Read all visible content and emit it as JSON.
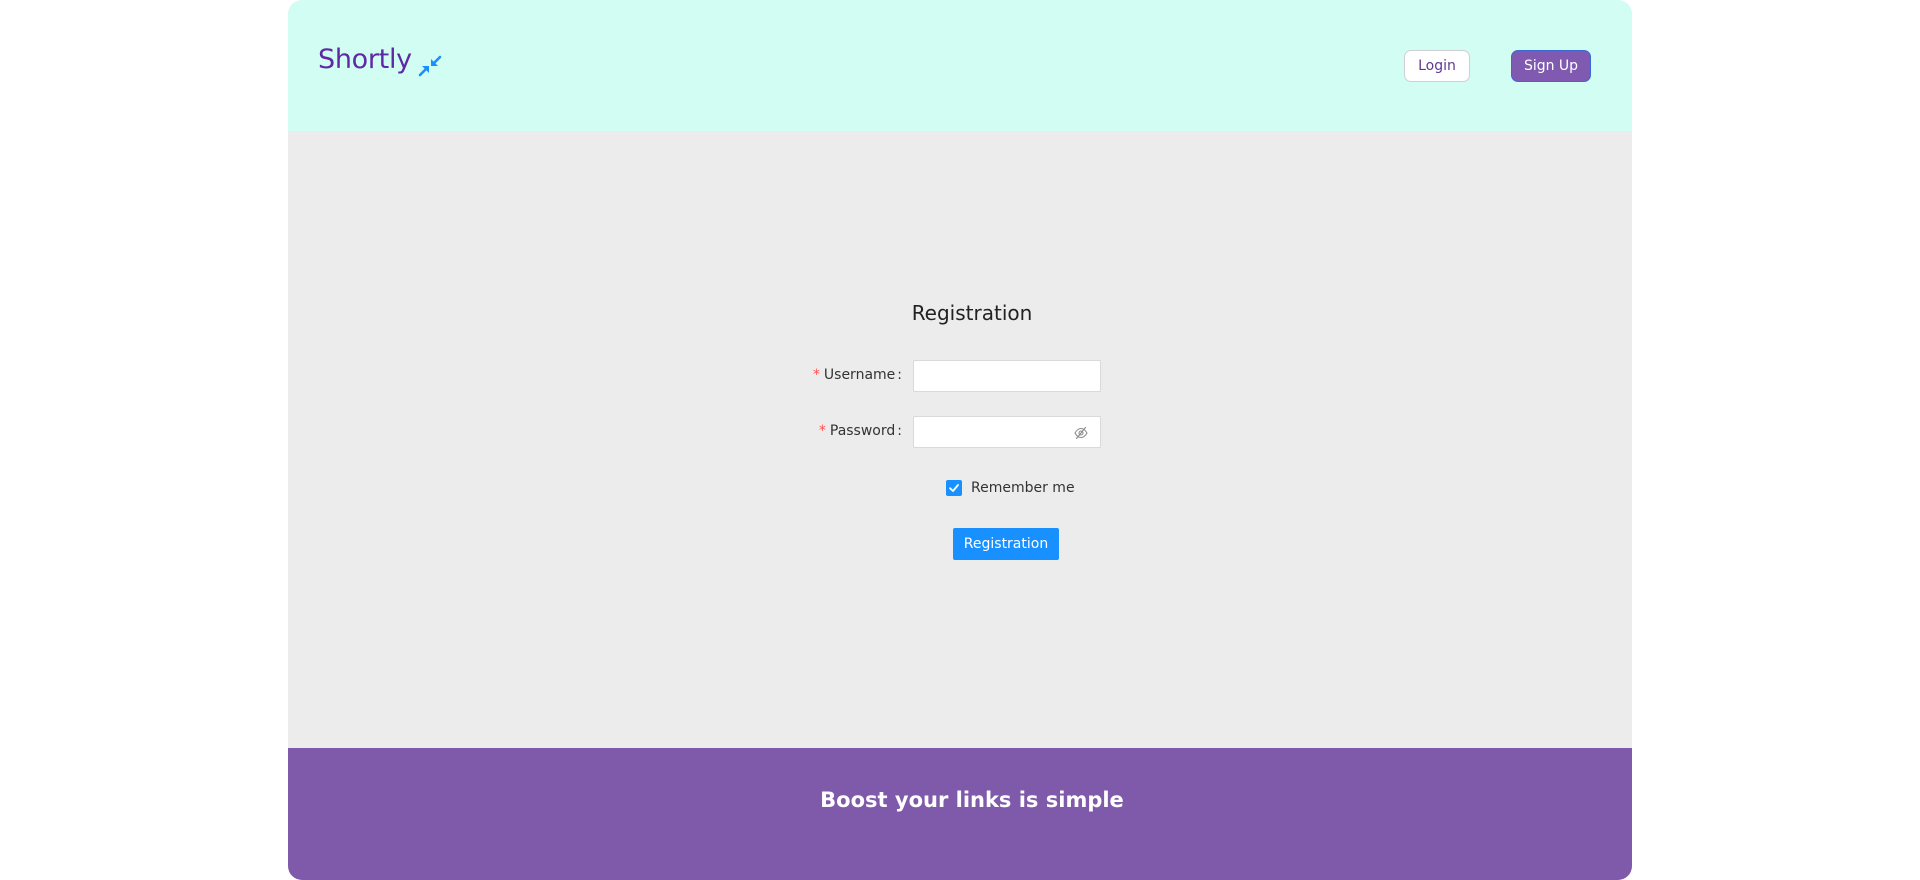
{
  "header": {
    "logo_text": "Shortly",
    "logo_icon": "compress-arrows-icon",
    "login_label": "Login",
    "signup_label": "Sign Up"
  },
  "form": {
    "title": "Registration",
    "username": {
      "required_mark": "*",
      "label": "Username",
      "colon": ":",
      "value": ""
    },
    "password": {
      "required_mark": "*",
      "label": "Password",
      "colon": ":",
      "value": "",
      "toggle_icon": "eye-invisible-icon"
    },
    "remember": {
      "label": "Remember me",
      "checked": true
    },
    "submit_label": "Registration"
  },
  "footer": {
    "tagline": "Boost your links is simple"
  },
  "colors": {
    "header_bg": "#d2fdf3",
    "body_bg": "#ececec",
    "footer_bg": "#7f5aaa",
    "brand": "#5e2aa3",
    "primary": "#1890ff",
    "required": "#ff4d4f"
  }
}
